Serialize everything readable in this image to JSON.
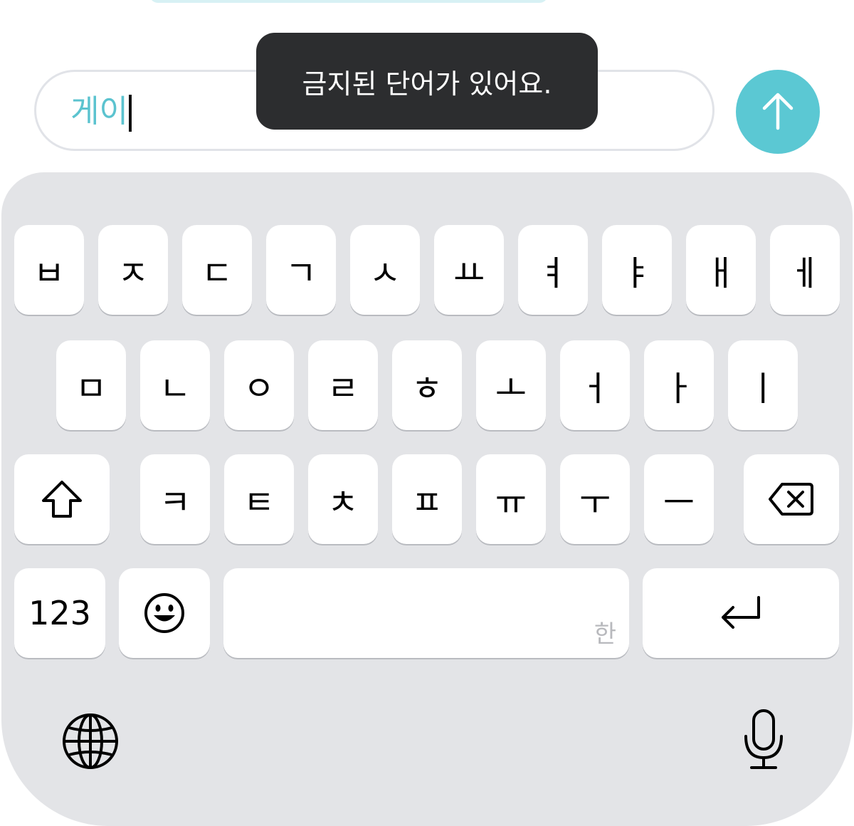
{
  "composer": {
    "input_value": "게이",
    "send_icon": "arrow-up-icon",
    "accent_color": "#5bc8d3"
  },
  "toast": {
    "message": "금지된 단어가 있어요."
  },
  "keyboard": {
    "row1": [
      "ㅂ",
      "ㅈ",
      "ㄷ",
      "ㄱ",
      "ㅅ",
      "ㅛ",
      "ㅕ",
      "ㅑ",
      "ㅐ",
      "ㅔ"
    ],
    "row2": [
      "ㅁ",
      "ㄴ",
      "ㅇ",
      "ㄹ",
      "ㅎ",
      "ㅗ",
      "ㅓ",
      "ㅏ",
      "ㅣ"
    ],
    "row3": [
      "ㅋ",
      "ㅌ",
      "ㅊ",
      "ㅍ",
      "ㅠ",
      "ㅜ",
      "ㅡ"
    ],
    "numbers_label": "123",
    "space_hint": "한",
    "icons": {
      "shift": "shift-icon",
      "backspace": "backspace-icon",
      "emoji": "emoji-icon",
      "return": "return-icon",
      "globe": "globe-icon",
      "microphone": "microphone-icon"
    }
  }
}
